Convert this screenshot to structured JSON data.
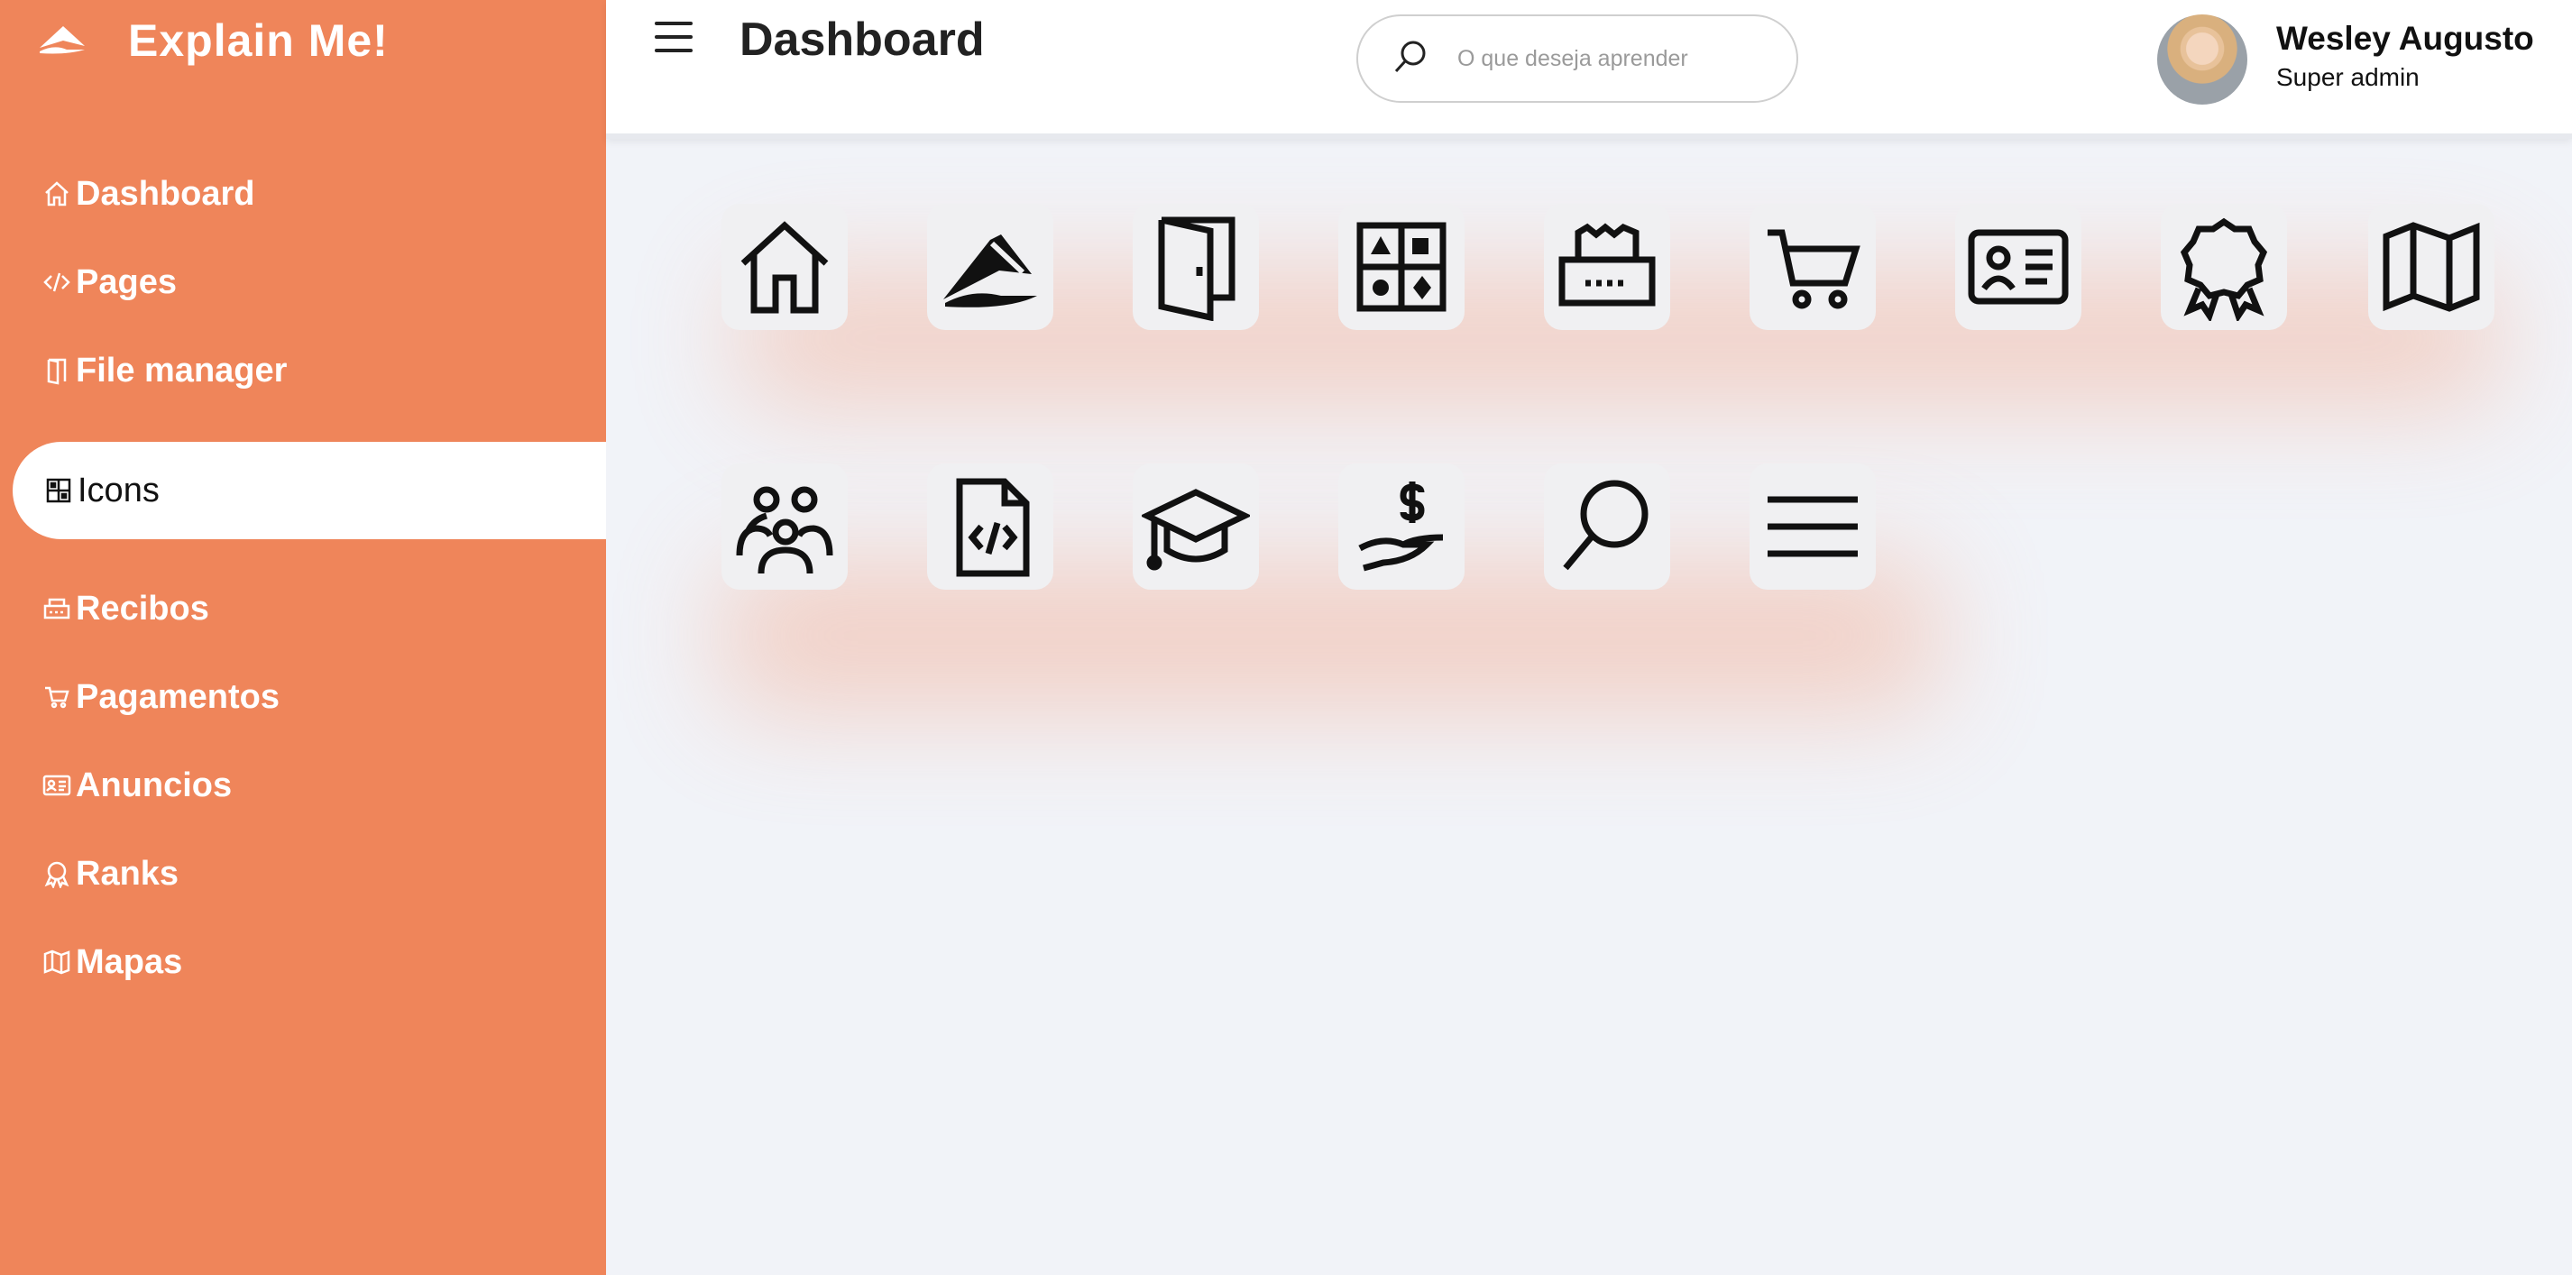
{
  "brand": {
    "name": "Explain Me!",
    "icon": "paper-plane-logo"
  },
  "header": {
    "title": "Dashboard",
    "search_placeholder": "O que deseja aprender",
    "user_name": "Wesley Augusto",
    "user_role": "Super admin"
  },
  "sidebar": {
    "items": [
      {
        "label": "Dashboard",
        "icon": "home-icon"
      },
      {
        "label": "Pages",
        "icon": "code-icon"
      },
      {
        "label": "File manager",
        "icon": "door-icon"
      },
      {
        "label": "Icons",
        "icon": "icons-grid-icon",
        "active": true
      },
      {
        "label": "Recibos",
        "icon": "receipt-printer-icon"
      },
      {
        "label": "Pagamentos",
        "icon": "cart-icon"
      },
      {
        "label": "Anuncios",
        "icon": "id-card-icon"
      },
      {
        "label": "Ranks",
        "icon": "award-icon"
      },
      {
        "label": "Mapas",
        "icon": "map-icon"
      }
    ]
  },
  "icon_grid": [
    "home-icon",
    "paper-plane-icon",
    "door-icon",
    "icons-grid-icon",
    "receipt-printer-icon",
    "cart-icon",
    "id-card-icon",
    "award-icon",
    "map-icon",
    "group-icon",
    "code-file-icon",
    "graduation-cap-icon",
    "payment-hand-icon",
    "search-icon",
    "menu-icon"
  ],
  "colors": {
    "sidebar": "#ef855a",
    "active_bg": "#ffffff",
    "background": "#f1f3f8"
  }
}
